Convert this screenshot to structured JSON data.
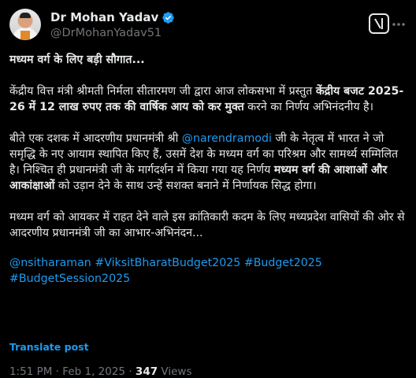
{
  "author": {
    "name": "Dr Mohan Yadav",
    "handle": "@DrMohanYadav51"
  },
  "post": {
    "heading": "मध्यम वर्ग के लिए बड़ी सौगात...",
    "p2": {
      "a": "केंद्रीय वित्त मंत्री श्रीमती निर्मला सीतारमण जी द्वारा आज लोकसभा में प्रस्तुत ",
      "b": "केंद्रीय बजट 2025-26 में 12 लाख रुपए तक की वार्षिक आय को कर मुक्त",
      "c": " करने का निर्णय अभिनंदनीय है।"
    },
    "p3": {
      "a": "बीते एक दशक में आदरणीय प्रधानमंत्री श्री ",
      "mention": "@narendramodi",
      "b": " जी के नेतृत्व में भारत ने जो समृद्धि के नए आयाम स्थापित किए हैं, उसमें देश के मध्यम वर्ग का परिश्रम और सामर्थ्य सम्मिलित है। निश्चित ही प्रधानमंत्री जी के मार्गदर्शन में किया गया यह निर्णय ",
      "c": "मध्यम वर्ग की आशाओं और आकांक्षाओं",
      "d": " को उड़ान देने के साथ उन्हें सशक्त बनाने में निर्णायक सिद्ध होगा।"
    },
    "p4": "मध्यम वर्ग को आयकर में राहत देने वाले इस क्रांतिकारी कदम के लिए मध्यप्रदेश वासियों की ओर से आदरणीय प्रधानमंत्री जी का आभार-अभिनंदन...",
    "tags": [
      "@nsitharaman",
      "#ViksitBharatBudget2025",
      "#Budget2025",
      "#BudgetSession2025"
    ]
  },
  "translate_label": "Translate post",
  "meta": {
    "time": "1:51 PM",
    "date": "Feb 1, 2025",
    "views": "347",
    "views_label": "Views"
  },
  "colors": {
    "background": "#000000",
    "text": "#e7e9ea",
    "muted": "#71767b",
    "link": "#1d9bf0",
    "verified": "#1d9bf0"
  }
}
